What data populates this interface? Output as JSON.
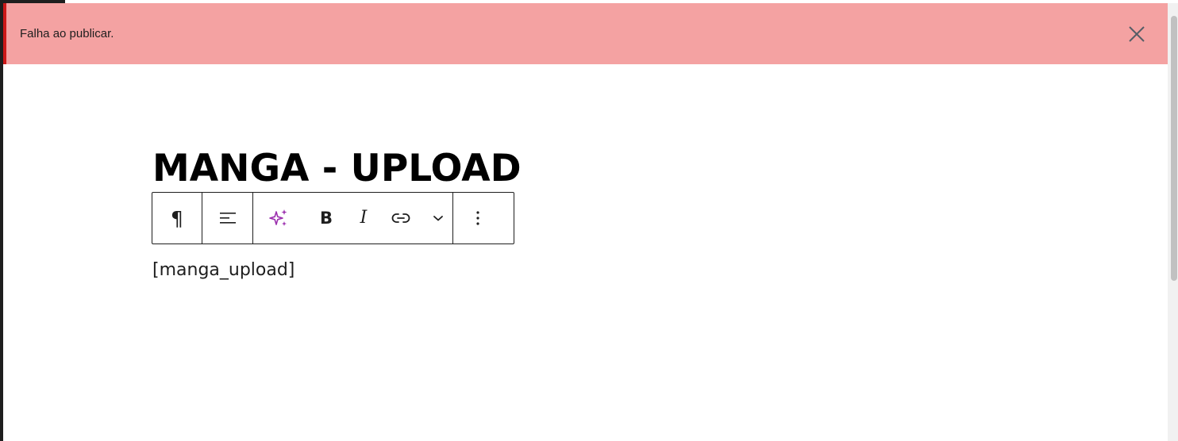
{
  "notice": {
    "message": "Falha ao publicar.",
    "close_icon": "close-icon",
    "background": "#f4a2a2",
    "accent": "#cc1818"
  },
  "post": {
    "title": "MANGA - UPLOAD",
    "paragraph": "[manga_upload]"
  },
  "toolbar": {
    "paragraph_glyph": "¶",
    "bold_glyph": "B",
    "italic_glyph": "I",
    "icons": [
      "paragraph-icon",
      "align-left-icon",
      "ai-sparkle-icon",
      "bold-icon",
      "italic-icon",
      "link-icon",
      "chevron-down-icon",
      "more-options-icon"
    ],
    "ai_color": "#9b2fae"
  }
}
